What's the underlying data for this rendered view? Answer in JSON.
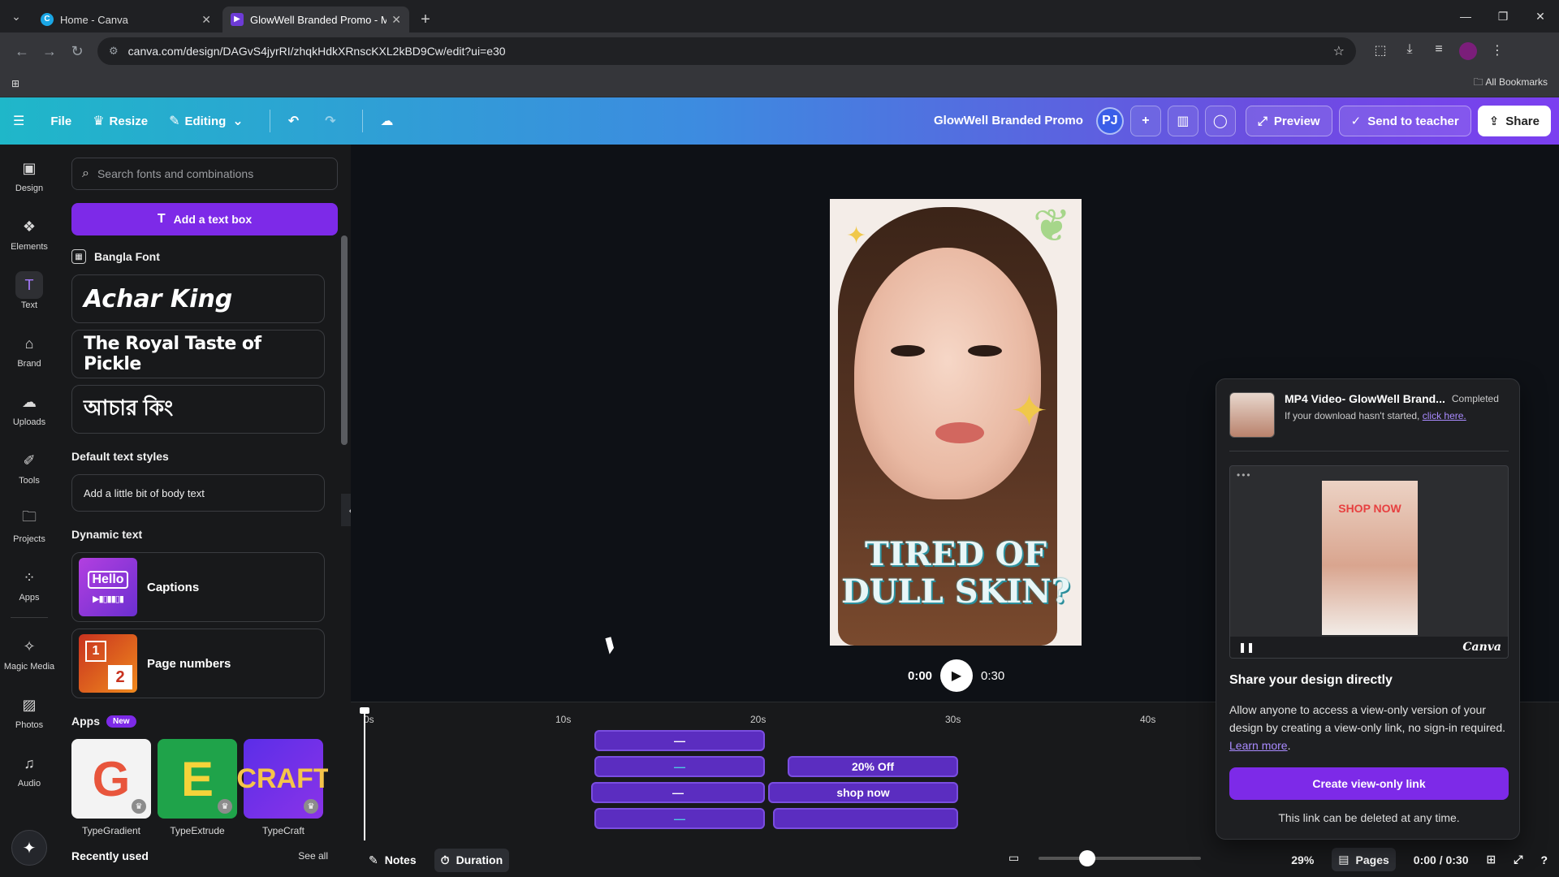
{
  "browser": {
    "tabs": [
      {
        "title": "Home - Canva",
        "active": false
      },
      {
        "title": "GlowWell Branded Promo - Mo",
        "active": true
      }
    ],
    "url": "canva.com/design/DAGvS4jyrRI/zhqkHdkXRnscKXL2kBD9Cw/edit?ui=e30",
    "bookmarks_label": "All Bookmarks"
  },
  "toolbar": {
    "file": "File",
    "resize": "Resize",
    "editing": "Editing",
    "doc_title": "GlowWell Branded Promo",
    "avatar_initials": "PJ",
    "preview": "Preview",
    "send_to_teacher": "Send to teacher",
    "share": "Share"
  },
  "rail": {
    "items": [
      {
        "label": "Design",
        "icon": "layout-icon"
      },
      {
        "label": "Elements",
        "icon": "shapes-icon"
      },
      {
        "label": "Text",
        "icon": "text-icon"
      },
      {
        "label": "Brand",
        "icon": "brand-icon"
      },
      {
        "label": "Uploads",
        "icon": "cloud-upload-icon"
      },
      {
        "label": "Tools",
        "icon": "pen-icon"
      },
      {
        "label": "Projects",
        "icon": "folder-icon"
      },
      {
        "label": "Apps",
        "icon": "apps-icon"
      },
      {
        "label": "Magic Media",
        "icon": "magic-media-icon"
      },
      {
        "label": "Photos",
        "icon": "photo-icon"
      },
      {
        "label": "Audio",
        "icon": "music-icon"
      }
    ]
  },
  "panel": {
    "search_placeholder": "Search fonts and combinations",
    "add_text_box": "Add a text box",
    "bangla_heading": "Bangla Font",
    "font_samples": [
      "Achar King",
      "The Royal Taste of Pickle",
      "আচার কিং"
    ],
    "default_heading": "Default text styles",
    "body_text": "Add a little bit of body text",
    "dynamic_heading": "Dynamic text",
    "captions": "Captions",
    "captions_thumb": "Hello",
    "page_numbers": "Page numbers",
    "pn_thumb_1": "1",
    "pn_thumb_2": "2",
    "apps_heading": "Apps",
    "apps_badge": "New",
    "apps": [
      {
        "name": "TypeGradient",
        "glyph": "G"
      },
      {
        "name": "TypeExtrude",
        "glyph": "E"
      },
      {
        "name": "TypeCraft",
        "glyph": "CRAFT"
      }
    ],
    "recently_used": "Recently used",
    "see_all": "See all"
  },
  "canvas": {
    "headline_line1": "TIRED OF",
    "headline_line2": "DULL SKIN?",
    "time_current": "0:00",
    "time_total": "0:30"
  },
  "timeline": {
    "ticks": [
      "0s",
      "10s",
      "20s",
      "30s",
      "40s"
    ],
    "clips": [
      {
        "label": "—"
      },
      {
        "label": "—"
      },
      {
        "label": "20% Off"
      },
      {
        "label": "—"
      },
      {
        "label": "shop now"
      },
      {
        "label": "—"
      }
    ]
  },
  "bottombar": {
    "notes": "Notes",
    "duration": "Duration",
    "zoom": "29%",
    "pages": "Pages",
    "time": "0:00 / 0:30"
  },
  "popover": {
    "file_title": "MP4 Video",
    "file_name": " - GlowWell Brand...",
    "status": "Completed",
    "hint": "If your download hasn't started, ",
    "hint_link": "click here.",
    "preview_shop": "SHOP NOW",
    "preview_logo": "Canva",
    "share_heading": "Share your design directly",
    "share_body": "Allow anyone to access a view-only version of your design by creating a view-only link, no sign-in required. ",
    "learn_more": "Learn more",
    "create_link": "Create view-only link",
    "footnote": "This link can be deleted at any time."
  }
}
